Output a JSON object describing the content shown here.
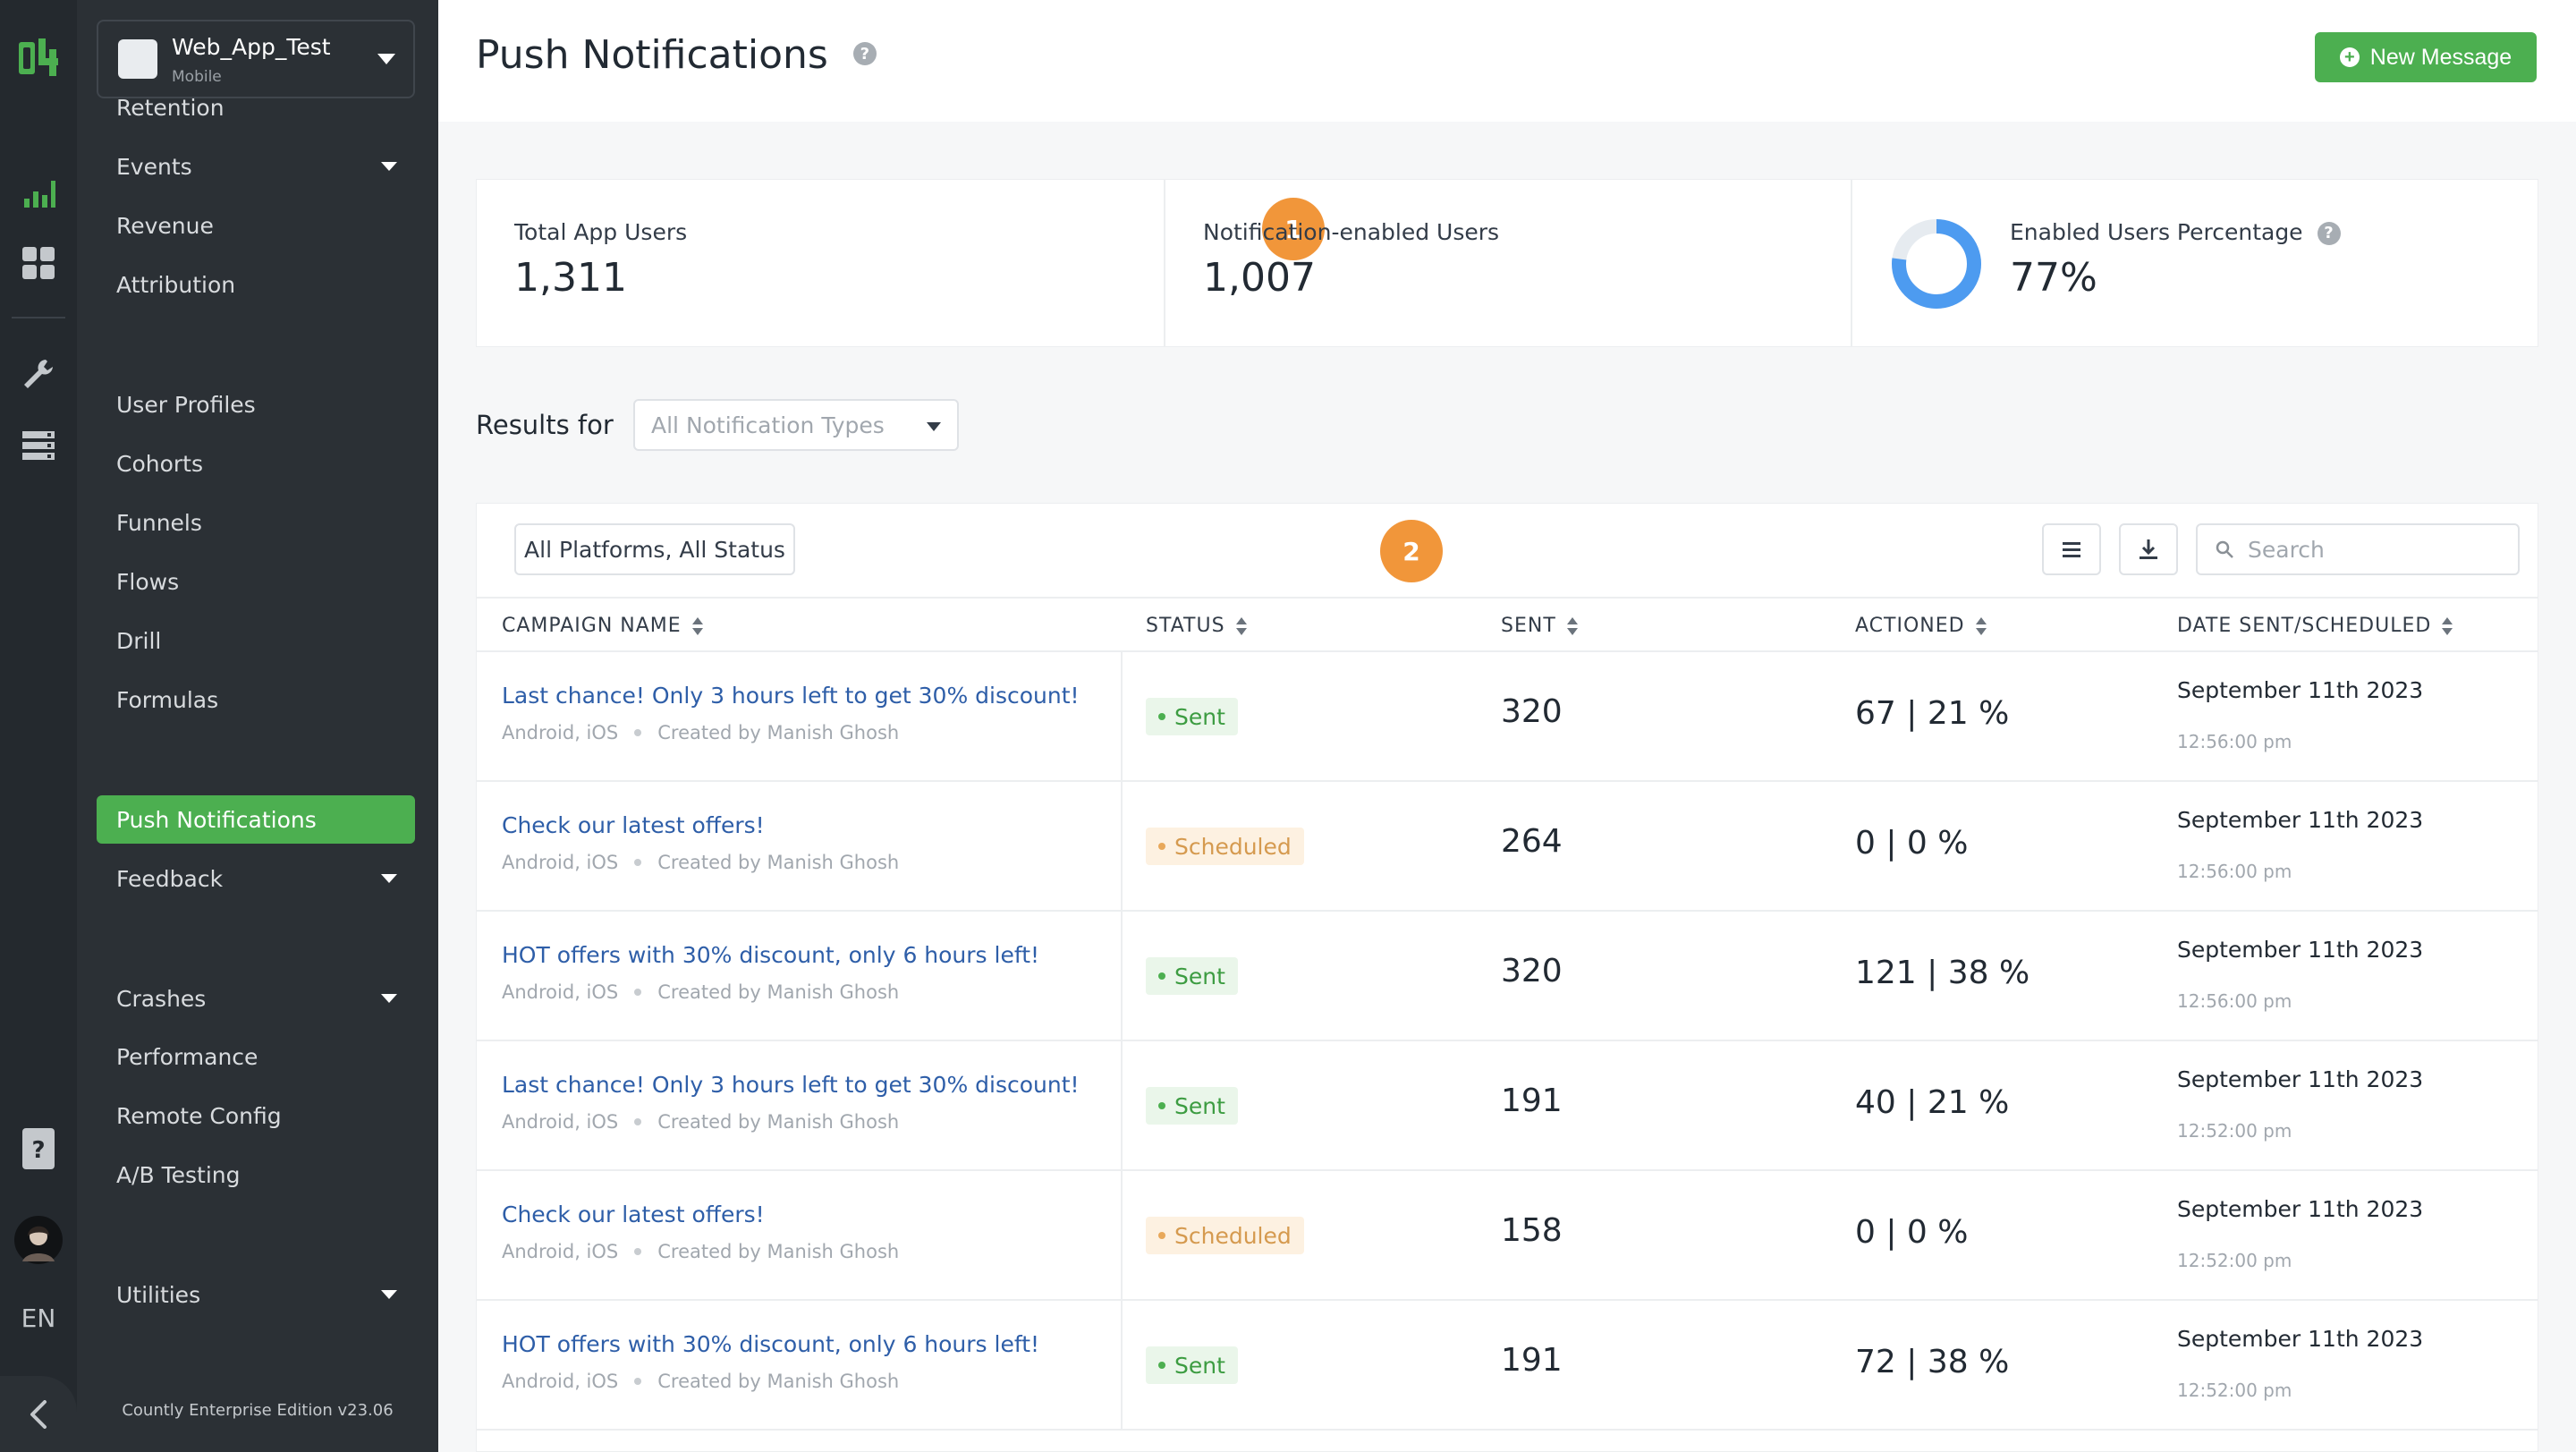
{
  "app": {
    "name": "Web_App_Test",
    "type": "Mobile"
  },
  "rail": {
    "language": "EN"
  },
  "nav": {
    "items": [
      {
        "label": "Retention",
        "caret": false
      },
      {
        "label": "Events",
        "caret": true
      },
      {
        "label": "Revenue",
        "caret": false
      },
      {
        "label": "Attribution",
        "caret": false
      },
      {
        "label": "User Profiles",
        "caret": false
      },
      {
        "label": "Cohorts",
        "caret": false
      },
      {
        "label": "Funnels",
        "caret": false
      },
      {
        "label": "Flows",
        "caret": false
      },
      {
        "label": "Drill",
        "caret": false
      },
      {
        "label": "Formulas",
        "caret": false
      },
      {
        "label": "Push Notifications",
        "caret": false,
        "active": true
      },
      {
        "label": "Feedback",
        "caret": true
      },
      {
        "label": "Crashes",
        "caret": true
      },
      {
        "label": "Performance",
        "caret": false
      },
      {
        "label": "Remote Config",
        "caret": false
      },
      {
        "label": "A/B Testing",
        "caret": false
      },
      {
        "label": "Utilities",
        "caret": true
      }
    ],
    "edition": "Countly Enterprise Edition v23.06"
  },
  "header": {
    "title": "Push Notifications",
    "help": "?",
    "new_message_label": "New Message"
  },
  "stats": {
    "total_users_label": "Total App Users",
    "total_users_value": "1,311",
    "enabled_users_label": "Notification-enabled Users",
    "enabled_users_value": "1,007",
    "percentage_label": "Enabled Users Percentage",
    "percentage_value": "77%",
    "percentage_fraction": 0.77,
    "marker_1": "1",
    "marker_2": "2"
  },
  "filters": {
    "results_for_label": "Results for",
    "notification_type_value": "All Notification Types",
    "platform_status_label": "All Platforms, All Status",
    "search_placeholder": "Search"
  },
  "table": {
    "columns": {
      "campaign": "CAMPAIGN NAME",
      "status": "STATUS",
      "sent": "SENT",
      "actioned": "ACTIONED",
      "date": "DATE SENT/SCHEDULED"
    },
    "rows": [
      {
        "name": "Last chance! Only 3 hours left to get 30% discount!",
        "platforms": "Android, iOS",
        "creator": "Created by Manish Ghosh",
        "status": "Sent",
        "sent": "320",
        "actioned": "67 | 21 %",
        "date": "September 11th 2023",
        "time": "12:56:00 pm"
      },
      {
        "name": "Check our latest offers!",
        "platforms": "Android, iOS",
        "creator": "Created by Manish Ghosh",
        "status": "Scheduled",
        "sent": "264",
        "actioned": "0 | 0 %",
        "date": "September 11th 2023",
        "time": "12:56:00 pm"
      },
      {
        "name": "HOT offers with 30% discount, only 6 hours left!",
        "platforms": "Android, iOS",
        "creator": "Created by Manish Ghosh",
        "status": "Sent",
        "sent": "320",
        "actioned": "121 | 38 %",
        "date": "September 11th 2023",
        "time": "12:56:00 pm"
      },
      {
        "name": "Last chance! Only 3 hours left to get 30% discount!",
        "platforms": "Android, iOS",
        "creator": "Created by Manish Ghosh",
        "status": "Sent",
        "sent": "191",
        "actioned": "40 | 21 %",
        "date": "September 11th 2023",
        "time": "12:52:00 pm"
      },
      {
        "name": "Check our latest offers!",
        "platforms": "Android, iOS",
        "creator": "Created by Manish Ghosh",
        "status": "Scheduled",
        "sent": "158",
        "actioned": "0 | 0 %",
        "date": "September 11th 2023",
        "time": "12:52:00 pm"
      },
      {
        "name": "HOT offers with 30% discount, only 6 hours left!",
        "platforms": "Android, iOS",
        "creator": "Created by Manish Ghosh",
        "status": "Sent",
        "sent": "191",
        "actioned": "72 | 38 %",
        "date": "September 11th 2023",
        "time": "12:52:00 pm"
      }
    ]
  },
  "colors": {
    "accent_green": "#4caf50",
    "donut_blue": "#4d9bf0",
    "marker_orange": "#f1963a"
  }
}
